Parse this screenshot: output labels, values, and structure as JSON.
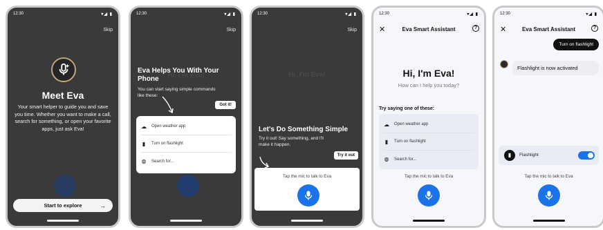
{
  "status": {
    "time": "12:30",
    "icons": "▾◢ ▮"
  },
  "screen1": {
    "skip": "Skip",
    "title": "Meet Eva",
    "description": "Your smart helper to guide you and save you time. Whether you want to make a call, search for something, or open your favorite apps, just ask Eva!",
    "cta": "Start to explore",
    "cta_icon": "→"
  },
  "screen2": {
    "skip": "Skip",
    "title": "Eva Helps You With Your Phone",
    "subtitle": "You can start saying simple commands like these:",
    "got_it": "Got it!",
    "bg_hi": "Hi, I'm Eva!",
    "suggestions": [
      "Open weather app",
      "Turn on flashlight",
      "Search for..."
    ]
  },
  "screen3": {
    "skip": "Skip",
    "bg_hi": "Hi, I'm Eva!",
    "title": "Let's Do Something Simple",
    "subtitle": "Try it out! Say something, and I'll make it happen.",
    "try_it": "Try it out",
    "tap_text": "Tap the mic to talk to Eva"
  },
  "screen4": {
    "close_icon": "✕",
    "title": "Eva Smart Assistant",
    "help_icon": "?",
    "hi": "Hi, I'm Eva!",
    "subtitle": "How can I help you today?",
    "try_label": "Try saying one of these:",
    "suggestions": [
      "Open weather app",
      "Turn on flashlight",
      "Search for..."
    ],
    "tap_text": "Tap the mic to talk to Eva"
  },
  "screen5": {
    "close_icon": "✕",
    "title": "Eva Smart Assistant",
    "help_icon": "?",
    "user_msg": "Turn on flashlight",
    "bot_msg": "Flashlight is now activated",
    "toggle_label": "Flashlight",
    "toggle_on": true,
    "tap_text": "Tap the mic to talk to Eva"
  },
  "colors": {
    "accent": "#1a73e8",
    "dark_bg": "#3a3a3a",
    "light_bg": "#f6f7fb",
    "logo_ring": "#c4a37f"
  }
}
